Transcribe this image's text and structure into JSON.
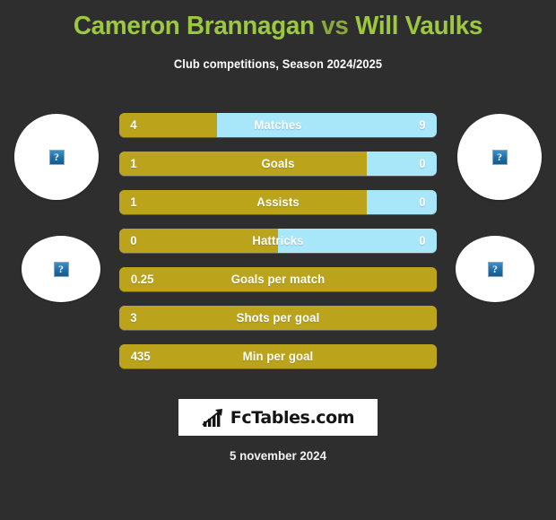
{
  "header": {
    "player_left": "Cameron Brannagan",
    "vs": "vs",
    "player_right": "Will Vaulks",
    "subtitle": "Club competitions, Season 2024/2025"
  },
  "colors": {
    "background": "#2e2e2e",
    "title_green": "#9cc840",
    "bar_gold": "#bba61c",
    "bar_blue": "#a8e6fa",
    "text_white": "#ffffff"
  },
  "avatars": [
    {
      "name": "avatar-left-top",
      "placeholder": "?"
    },
    {
      "name": "avatar-left-bottom",
      "placeholder": "?"
    },
    {
      "name": "avatar-right-top",
      "placeholder": "?"
    },
    {
      "name": "avatar-right-bottom",
      "placeholder": "?"
    }
  ],
  "chart_data": {
    "type": "bar",
    "title": "Cameron Brannagan vs Will Vaulks",
    "subtitle": "Club competitions, Season 2024/2025",
    "orientation": "horizontal-diverging",
    "series": [
      {
        "name": "Cameron Brannagan",
        "color": "#bba41c",
        "side": "left"
      },
      {
        "name": "Will Vaulks",
        "color": "#a8e6fa",
        "side": "right"
      }
    ],
    "categories": [
      "Matches",
      "Goals",
      "Assists",
      "Hattricks",
      "Goals per match",
      "Shots per goal",
      "Min per goal"
    ],
    "rows": [
      {
        "label": "Matches",
        "left": "4",
        "right": "9",
        "left_pct": 30.8,
        "two_sided": true
      },
      {
        "label": "Goals",
        "left": "1",
        "right": "0",
        "left_pct": 78.0,
        "two_sided": true
      },
      {
        "label": "Assists",
        "left": "1",
        "right": "0",
        "left_pct": 78.0,
        "two_sided": true
      },
      {
        "label": "Hattricks",
        "left": "0",
        "right": "0",
        "left_pct": 50.0,
        "two_sided": true
      },
      {
        "label": "Goals per match",
        "left": "0.25",
        "right": "",
        "left_pct": 100,
        "two_sided": false
      },
      {
        "label": "Shots per goal",
        "left": "3",
        "right": "",
        "left_pct": 100,
        "two_sided": false
      },
      {
        "label": "Min per goal",
        "left": "435",
        "right": "",
        "left_pct": 100,
        "two_sided": false
      }
    ]
  },
  "logo": {
    "text": "FcTables.com",
    "icon": "bar-chart-trend-icon"
  },
  "footer": {
    "date": "5 november 2024"
  }
}
